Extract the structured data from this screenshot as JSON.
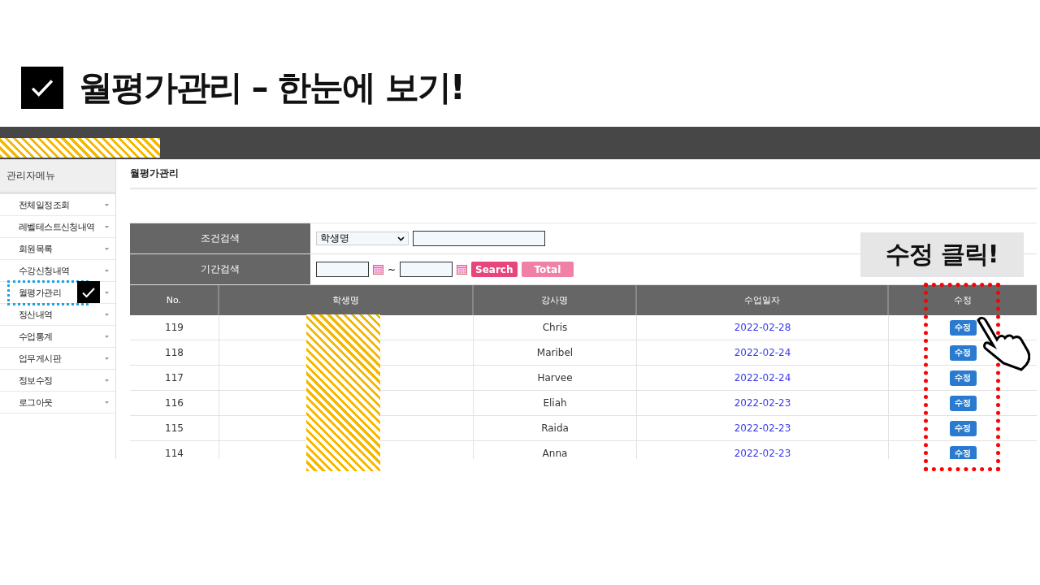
{
  "slide_title": "월평가관리 – 한눈에 보기!",
  "sidebar": {
    "heading": "관리자메뉴",
    "items": [
      {
        "label": "전체일정조회",
        "annotated": false
      },
      {
        "label": "레벨테스트신청내역",
        "annotated": false
      },
      {
        "label": "회원목록",
        "annotated": false
      },
      {
        "label": "수강신청내역",
        "annotated": false
      },
      {
        "label": "월평가관리",
        "annotated": true
      },
      {
        "label": "정산내역",
        "annotated": false
      },
      {
        "label": "수업통계",
        "annotated": false
      },
      {
        "label": "업무게시판",
        "annotated": false
      },
      {
        "label": "정보수정",
        "annotated": false
      },
      {
        "label": "로그아웃",
        "annotated": false
      }
    ]
  },
  "page_title": "월평가관리",
  "search": {
    "condition_label": "조건검색",
    "condition_select": "학생명",
    "period_label": "기간검색",
    "range_separator": "~",
    "search_button": "Search",
    "total_button": "Total"
  },
  "table": {
    "columns": [
      "No.",
      "학생명",
      "강사명",
      "수업일자",
      "수정"
    ],
    "rows": [
      {
        "no": "119",
        "teacher": "Chris",
        "date": "2022-02-28",
        "action": "수정"
      },
      {
        "no": "118",
        "teacher": "Maribel",
        "date": "2022-02-24",
        "action": "수정"
      },
      {
        "no": "117",
        "teacher": "Harvee",
        "date": "2022-02-24",
        "action": "수정"
      },
      {
        "no": "116",
        "teacher": "Eliah",
        "date": "2022-02-23",
        "action": "수정"
      },
      {
        "no": "115",
        "teacher": "Raida",
        "date": "2022-02-23",
        "action": "수정"
      },
      {
        "no": "114",
        "teacher": "Anna",
        "date": "2022-02-23",
        "action": "수정"
      }
    ]
  },
  "callout": "수정 클릭!"
}
